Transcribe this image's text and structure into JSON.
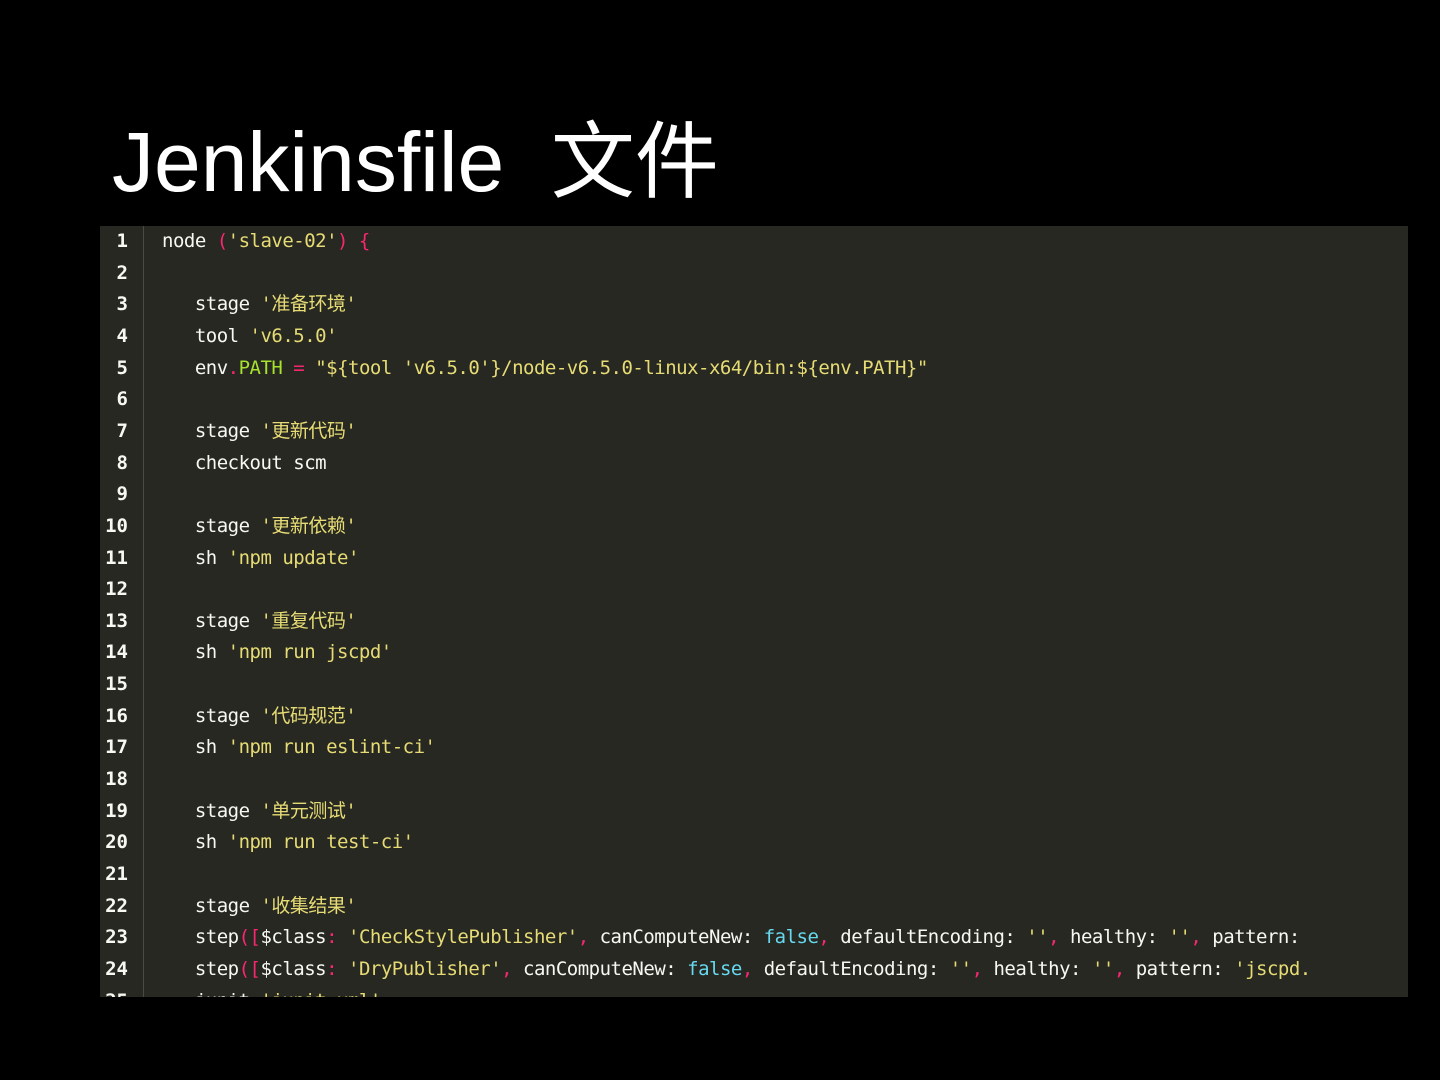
{
  "title": "Jenkinsfile  文件",
  "colors": {
    "background": "#272822",
    "plain": "#f8f8f2",
    "string": "#e6db74",
    "punctuation": "#f92672",
    "keyword": "#66d9ef",
    "property": "#a6e22e"
  },
  "code": {
    "lines": [
      [
        [
          "node ",
          "plain"
        ],
        [
          "(",
          "punc"
        ],
        [
          "'slave-02'",
          "str"
        ],
        [
          ") {",
          "punc"
        ]
      ],
      [],
      [
        [
          "   stage ",
          "plain"
        ],
        [
          "'准备环境'",
          "str"
        ]
      ],
      [
        [
          "   tool ",
          "plain"
        ],
        [
          "'v6.5.0'",
          "str"
        ]
      ],
      [
        [
          "   env",
          "plain"
        ],
        [
          ".",
          "punc"
        ],
        [
          "PATH",
          "prop"
        ],
        [
          " = ",
          "punc"
        ],
        [
          "\"${tool 'v6.5.0'}/node-v6.5.0-linux-x64/bin:${env.PATH}\"",
          "str"
        ]
      ],
      [],
      [
        [
          "   stage ",
          "plain"
        ],
        [
          "'更新代码'",
          "str"
        ]
      ],
      [
        [
          "   checkout scm",
          "plain"
        ]
      ],
      [],
      [
        [
          "   stage ",
          "plain"
        ],
        [
          "'更新依赖'",
          "str"
        ]
      ],
      [
        [
          "   sh ",
          "plain"
        ],
        [
          "'npm update'",
          "str"
        ]
      ],
      [],
      [
        [
          "   stage ",
          "plain"
        ],
        [
          "'重复代码'",
          "str"
        ]
      ],
      [
        [
          "   sh ",
          "plain"
        ],
        [
          "'npm run jscpd'",
          "str"
        ]
      ],
      [],
      [
        [
          "   stage ",
          "plain"
        ],
        [
          "'代码规范'",
          "str"
        ]
      ],
      [
        [
          "   sh ",
          "plain"
        ],
        [
          "'npm run eslint-ci'",
          "str"
        ]
      ],
      [],
      [
        [
          "   stage ",
          "plain"
        ],
        [
          "'单元测试'",
          "str"
        ]
      ],
      [
        [
          "   sh ",
          "plain"
        ],
        [
          "'npm run test-ci'",
          "str"
        ]
      ],
      [],
      [
        [
          "   stage ",
          "plain"
        ],
        [
          "'收集结果'",
          "str"
        ]
      ],
      [
        [
          "   step",
          "plain"
        ],
        [
          "([",
          "punc"
        ],
        [
          "$class",
          "plain"
        ],
        [
          ": ",
          "punc"
        ],
        [
          "'CheckStylePublisher'",
          "str"
        ],
        [
          ", ",
          "punc"
        ],
        [
          "canComputeNew: ",
          "plain"
        ],
        [
          "false",
          "kw"
        ],
        [
          ", ",
          "punc"
        ],
        [
          "defaultEncoding: ",
          "plain"
        ],
        [
          "''",
          "str"
        ],
        [
          ", ",
          "punc"
        ],
        [
          "healthy: ",
          "plain"
        ],
        [
          "''",
          "str"
        ],
        [
          ", ",
          "punc"
        ],
        [
          "pattern: ",
          "plain"
        ]
      ],
      [
        [
          "   step",
          "plain"
        ],
        [
          "([",
          "punc"
        ],
        [
          "$class",
          "plain"
        ],
        [
          ": ",
          "punc"
        ],
        [
          "'DryPublisher'",
          "str"
        ],
        [
          ", ",
          "punc"
        ],
        [
          "canComputeNew: ",
          "plain"
        ],
        [
          "false",
          "kw"
        ],
        [
          ", ",
          "punc"
        ],
        [
          "defaultEncoding: ",
          "plain"
        ],
        [
          "''",
          "str"
        ],
        [
          ", ",
          "punc"
        ],
        [
          "healthy: ",
          "plain"
        ],
        [
          "''",
          "str"
        ],
        [
          ", ",
          "punc"
        ],
        [
          "pattern: ",
          "plain"
        ],
        [
          "'jscpd.",
          "str"
        ]
      ],
      [
        [
          "   junit ",
          "plain"
        ],
        [
          "'junit.xml'",
          "str"
        ]
      ]
    ]
  }
}
